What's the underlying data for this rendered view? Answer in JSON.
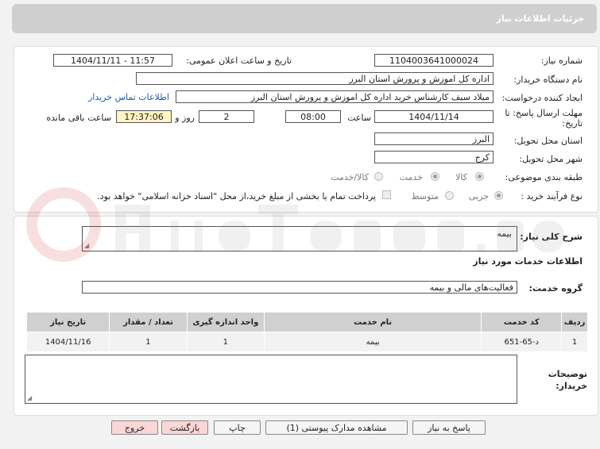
{
  "header": {
    "title": "جزئیات اطلاعات نیاز"
  },
  "form": {
    "need_number_label": "شماره نیاز:",
    "need_number": "1104003641000024",
    "announce_label": "تاریخ و ساعت اعلان عمومی:",
    "announce_value": "1404/11/11 - 11:57",
    "buyer_label": "نام دستگاه خریدار:",
    "buyer_value": "اداره کل اموزش و پرورش استان البرز",
    "creator_label": "ایجاد کننده درخواست:",
    "creator_value": "میلاد  سیف  کارشناس خرید  اداره کل اموزش و پرورش استان البرز",
    "contact_link": "اطلاعات تماس خریدار",
    "deadline_label_1": "مهلت ارسال پاسخ: تا",
    "deadline_label_2": "تاریخ:",
    "deadline_date": "1404/11/14",
    "hour_label": "ساعت",
    "deadline_time": "08:00",
    "days_value": "2",
    "days_label": "روز و",
    "remaining_time": "17:37:06",
    "remaining_label": "ساعت باقی مانده",
    "province_label": "استان محل تحویل:",
    "province_value": "البرز",
    "city_label": "شهر محل تحویل:",
    "city_value": "کرج",
    "category_label": "طبقه بندی موضوعی:",
    "cat_goods": "کالا",
    "cat_service": "خدمت",
    "cat_goods_service": "کالا/خدمت",
    "purchase_type_label": "نوع فرآیند خرید :",
    "pt_minor": "جزیی",
    "pt_medium": "متوسط",
    "payment_note": "پرداخت تمام یا بخشی از مبلغ خرید،از محل \"اسناد خزانه اسلامی\" خواهد بود."
  },
  "general": {
    "desc_label": "شرح کلی نیاز:",
    "desc_value": "بیمه",
    "services_title": "اطلاعات خدمات مورد نیاز",
    "group_label": "گروه خدمت:",
    "group_value": "فعالیت‌های مالی و بیمه"
  },
  "table": {
    "headers": [
      "ردیف",
      "کد خدمت",
      "نام خدمت",
      "واحد اندازه گیری",
      "تعداد / مقدار",
      "تاریخ نیاز"
    ],
    "rows": [
      [
        "1",
        "د-65-651",
        "بیمه",
        "1",
        "1",
        "1404/11/16"
      ]
    ]
  },
  "buyer_notes": {
    "label_1": "توضیحات",
    "label_2": "خریدار:",
    "value": ""
  },
  "buttons": {
    "reply": "پاسخ به نیاز",
    "attachments": "مشاهده مدارک پیوستی (1)",
    "print": "چاپ",
    "back": "بازگشت",
    "exit": "خروج"
  },
  "colors": {
    "highlight": "#fff4c2",
    "link": "#1a5dbb",
    "header_bg": "#cfcfcf"
  }
}
